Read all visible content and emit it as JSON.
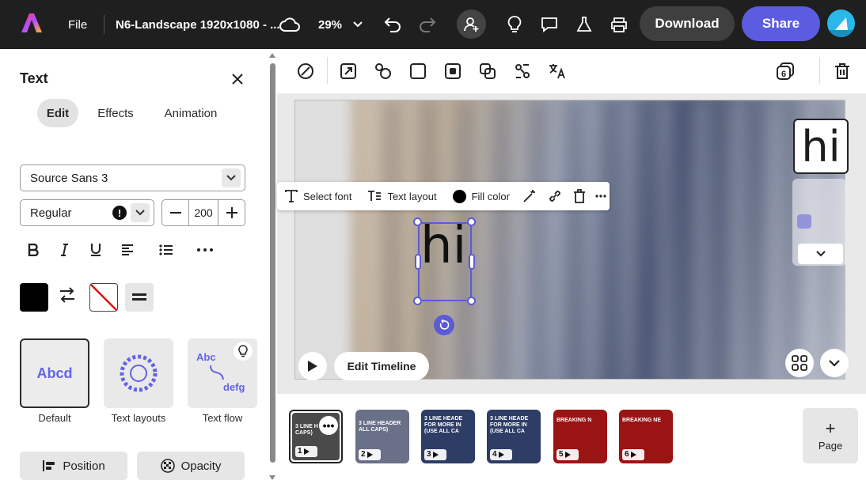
{
  "topbar": {
    "file": "File",
    "title": "N6-Landscape 1920x1080 - ...",
    "zoom": "29%",
    "download": "Download",
    "share": "Share"
  },
  "panel": {
    "title": "Text",
    "tabs": [
      {
        "label": "Edit",
        "active": true
      },
      {
        "label": "Effects",
        "active": false
      },
      {
        "label": "Animation",
        "active": false
      }
    ],
    "font": "Source Sans 3",
    "weight": "Regular",
    "size": "200",
    "fill_color": "#000000",
    "text_styles": [
      {
        "label": "Default",
        "preview": "Abcd"
      },
      {
        "label": "Text layouts"
      },
      {
        "label": "Text flow",
        "preview_top": "Abc",
        "preview_bottom": "defg"
      }
    ],
    "position_label": "Position",
    "opacity_label": "Opacity"
  },
  "context_bar": {
    "select_font": "Select font",
    "text_layout": "Text layout",
    "fill_color": "Fill color"
  },
  "canvas": {
    "selected_text": "hi",
    "edit_timeline": "Edit Timeline",
    "side_preview_text": "hi",
    "layers_count": "6"
  },
  "pages": [
    {
      "number": "1",
      "selected": true,
      "caption": "3 LINE H ALL CAPS)",
      "color": "#4a4a4a"
    },
    {
      "number": "2",
      "selected": false,
      "caption": "3 LINE HEADER ALL CAPS)",
      "color": "#6a7088"
    },
    {
      "number": "3",
      "selected": false,
      "caption": "3 LINE HEADE FOR MORE IN (USE ALL CA",
      "color": "#2e3d66"
    },
    {
      "number": "4",
      "selected": false,
      "caption": "3 LINE HEADE FOR MORE IN (USE ALL CA",
      "color": "#2e3d66"
    },
    {
      "number": "5",
      "selected": false,
      "caption": "BREAKING N",
      "color": "#9a1414"
    },
    {
      "number": "6",
      "selected": false,
      "caption": "BREAKING NE",
      "color": "#9a1414"
    }
  ],
  "add_page": {
    "label": "Page",
    "icon": "+"
  },
  "colors": {
    "accent": "#5c5ce0",
    "selection": "#5b5bd6",
    "topbar": "#1f1f1f"
  }
}
